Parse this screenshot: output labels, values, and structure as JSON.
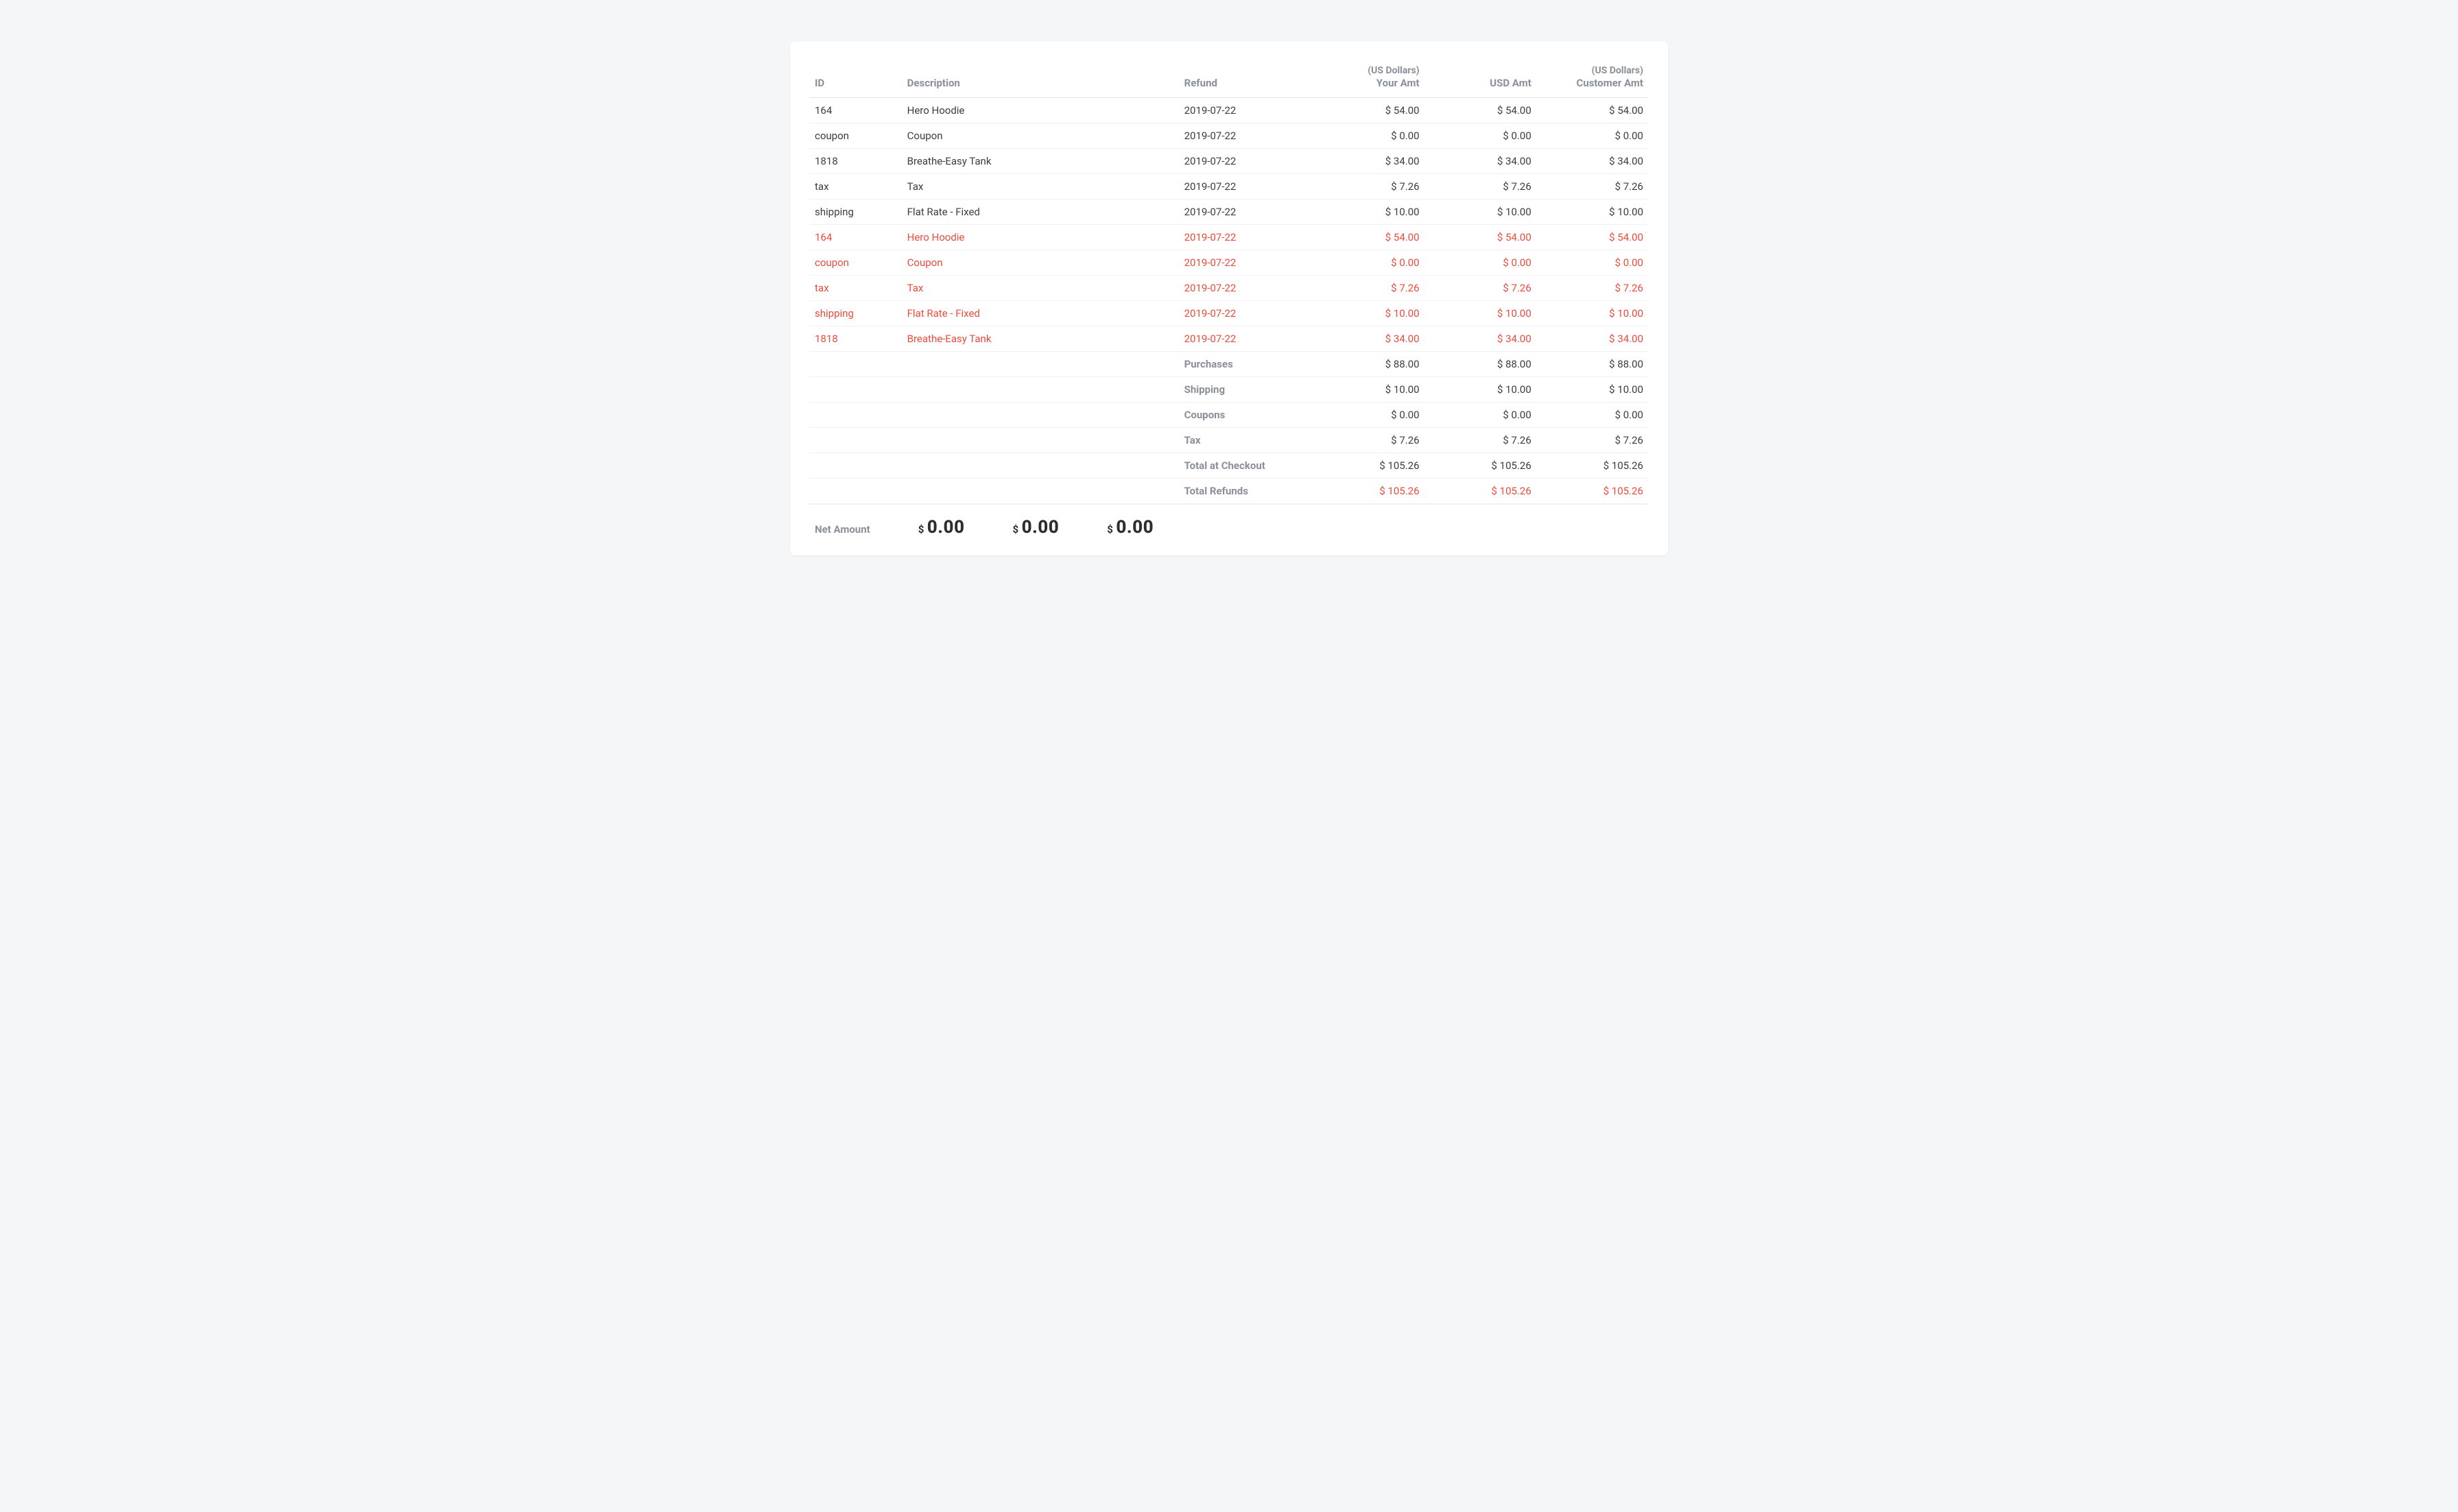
{
  "headers": {
    "id": "ID",
    "description": "Description",
    "refund": "Refund",
    "your_amt_sub": "(US Dollars)",
    "your_amt": "Your Amt",
    "usd_amt": "USD Amt",
    "cust_amt_sub": "(US Dollars)",
    "cust_amt": "Customer Amt"
  },
  "rows": [
    {
      "id": "164",
      "desc": "Hero Hoodie",
      "refund": "2019-07-22",
      "your": "$ 54.00",
      "usd": "$ 54.00",
      "cust": "$ 54.00",
      "is_refund": false
    },
    {
      "id": "coupon",
      "desc": "Coupon",
      "refund": "2019-07-22",
      "your": "$ 0.00",
      "usd": "$ 0.00",
      "cust": "$ 0.00",
      "is_refund": false
    },
    {
      "id": "1818",
      "desc": "Breathe-Easy Tank",
      "refund": "2019-07-22",
      "your": "$ 34.00",
      "usd": "$ 34.00",
      "cust": "$ 34.00",
      "is_refund": false
    },
    {
      "id": "tax",
      "desc": "Tax",
      "refund": "2019-07-22",
      "your": "$ 7.26",
      "usd": "$ 7.26",
      "cust": "$ 7.26",
      "is_refund": false
    },
    {
      "id": "shipping",
      "desc": "Flat Rate - Fixed",
      "refund": "2019-07-22",
      "your": "$ 10.00",
      "usd": "$ 10.00",
      "cust": "$ 10.00",
      "is_refund": false
    },
    {
      "id": "164",
      "desc": "Hero Hoodie",
      "refund": "2019-07-22",
      "your": "$ 54.00",
      "usd": "$ 54.00",
      "cust": "$ 54.00",
      "is_refund": true
    },
    {
      "id": "coupon",
      "desc": "Coupon",
      "refund": "2019-07-22",
      "your": "$ 0.00",
      "usd": "$ 0.00",
      "cust": "$ 0.00",
      "is_refund": true
    },
    {
      "id": "tax",
      "desc": "Tax",
      "refund": "2019-07-22",
      "your": "$ 7.26",
      "usd": "$ 7.26",
      "cust": "$ 7.26",
      "is_refund": true
    },
    {
      "id": "shipping",
      "desc": "Flat Rate - Fixed",
      "refund": "2019-07-22",
      "your": "$ 10.00",
      "usd": "$ 10.00",
      "cust": "$ 10.00",
      "is_refund": true
    },
    {
      "id": "1818",
      "desc": "Breathe-Easy Tank",
      "refund": "2019-07-22",
      "your": "$ 34.00",
      "usd": "$ 34.00",
      "cust": "$ 34.00",
      "is_refund": true
    }
  ],
  "summary": [
    {
      "label": "Purchases",
      "your": "$ 88.00",
      "usd": "$ 88.00",
      "cust": "$ 88.00",
      "refund": false
    },
    {
      "label": "Shipping",
      "your": "$ 10.00",
      "usd": "$ 10.00",
      "cust": "$ 10.00",
      "refund": false
    },
    {
      "label": "Coupons",
      "your": "$ 0.00",
      "usd": "$ 0.00",
      "cust": "$ 0.00",
      "refund": false
    },
    {
      "label": "Tax",
      "your": "$ 7.26",
      "usd": "$ 7.26",
      "cust": "$ 7.26",
      "refund": false
    },
    {
      "label": "Total at Checkout",
      "your": "$ 105.26",
      "usd": "$ 105.26",
      "cust": "$ 105.26",
      "refund": false
    },
    {
      "label": "Total Refunds",
      "your": "$ 105.26",
      "usd": "$ 105.26",
      "cust": "$ 105.26",
      "refund": true
    }
  ],
  "net": {
    "label": "Net Amount",
    "currency": "$",
    "your": "0.00",
    "usd": "0.00",
    "cust": "0.00"
  }
}
